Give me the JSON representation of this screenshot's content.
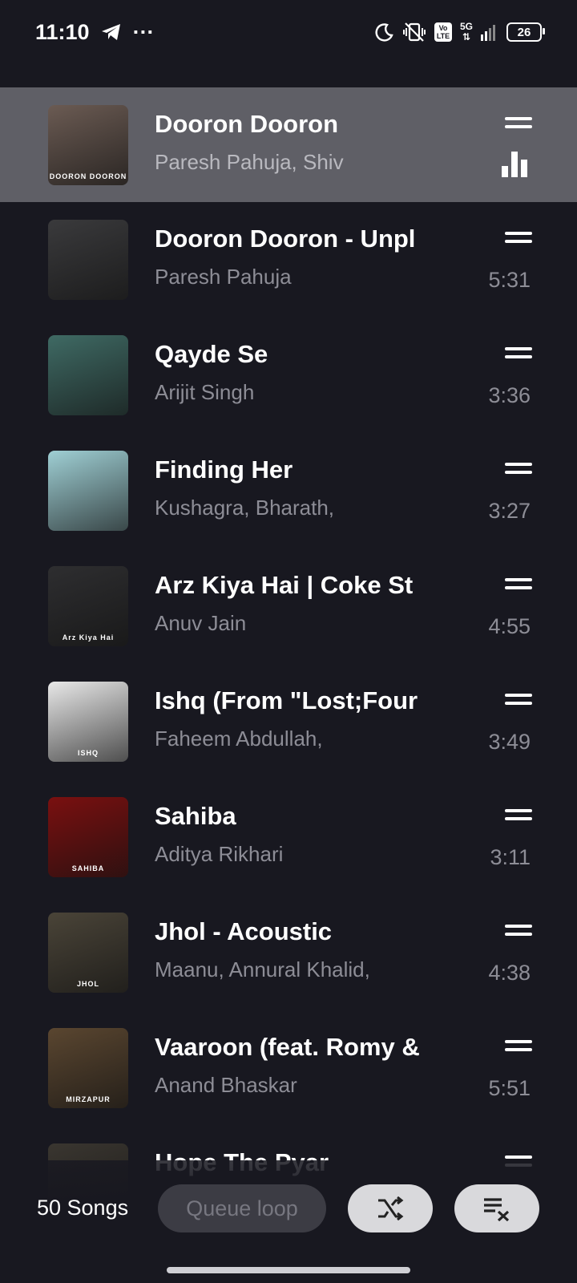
{
  "status_bar": {
    "time": "11:10",
    "overflow": "···",
    "volte_top": "Vo",
    "volte_bottom": "LTE",
    "network": "5G",
    "battery": "26",
    "icons": [
      "telegram-icon",
      "moon-icon",
      "vibrate-off-icon",
      "signal-icon",
      "battery-icon"
    ]
  },
  "songs": [
    {
      "title": "Dooron Dooron",
      "artist": "Paresh Pahuja, Shiv",
      "duration": "",
      "playing": true,
      "thumb_caption": "DOORON DOORON",
      "thumb_color": "#6b5b53"
    },
    {
      "title": "Dooron Dooron - Unpl",
      "artist": "Paresh Pahuja",
      "duration": "5:31",
      "playing": false,
      "thumb_caption": "",
      "thumb_color": "#3a3a3c"
    },
    {
      "title": "Qayde Se",
      "artist": "Arijit Singh",
      "duration": "3:36",
      "playing": false,
      "thumb_caption": "",
      "thumb_color": "#3f6a64"
    },
    {
      "title": "Finding Her",
      "artist": "Kushagra, Bharath,",
      "duration": "3:27",
      "playing": false,
      "thumb_caption": "",
      "thumb_color": "#9fcfd4"
    },
    {
      "title": "Arz Kiya Hai | Coke St",
      "artist": "Anuv Jain",
      "duration": "4:55",
      "playing": false,
      "thumb_caption": "Arz Kiya Hai",
      "thumb_color": "#2e2e30"
    },
    {
      "title": "Ishq (From \"Lost;Four",
      "artist": "Faheem Abdullah,",
      "duration": "3:49",
      "playing": false,
      "thumb_caption": "ISHQ",
      "thumb_color": "#e8e8e8"
    },
    {
      "title": "Sahiba",
      "artist": "Aditya Rikhari",
      "duration": "3:11",
      "playing": false,
      "thumb_caption": "SAHIBA",
      "thumb_color": "#7a1010"
    },
    {
      "title": "Jhol - Acoustic",
      "artist": "Maanu, Annural Khalid,",
      "duration": "4:38",
      "playing": false,
      "thumb_caption": "JHOL",
      "thumb_color": "#4a4438"
    },
    {
      "title": "Vaaroon (feat. Romy &",
      "artist": "Anand Bhaskar",
      "duration": "5:51",
      "playing": false,
      "thumb_caption": "MIRZAPUR",
      "thumb_color": "#5a4630"
    },
    {
      "title": "Hope The Pyar",
      "artist": "",
      "duration": "",
      "playing": false,
      "thumb_caption": "",
      "thumb_color": "#3a3630"
    }
  ],
  "footer": {
    "songs_count": "50 Songs",
    "queue_loop_label": "Queue loop",
    "shuffle_icon": "shuffle-icon",
    "clear_queue_icon": "clear-queue-icon"
  }
}
